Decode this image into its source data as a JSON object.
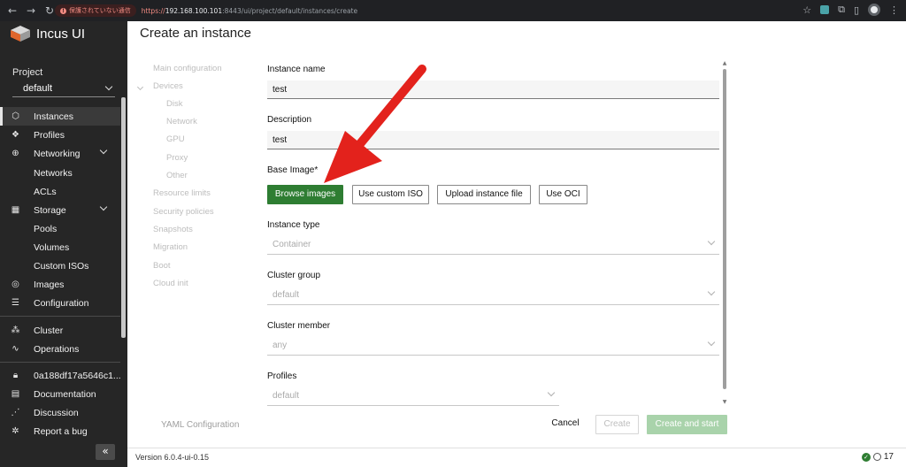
{
  "browser": {
    "security_warning": "保護されていない通信",
    "url_scheme": "https://",
    "url_host": "192.168.100.101",
    "url_rest": ":8443/ui/project/default/instances/create"
  },
  "sidebar": {
    "brand": "Incus UI",
    "project_label": "Project",
    "project_value": "default",
    "items": [
      {
        "label": "Instances",
        "icon": "instances-icon"
      },
      {
        "label": "Profiles",
        "icon": "profiles-icon"
      },
      {
        "label": "Networking",
        "icon": "networking-icon"
      },
      {
        "label": "Networks"
      },
      {
        "label": "ACLs"
      },
      {
        "label": "Storage",
        "icon": "storage-icon"
      },
      {
        "label": "Pools"
      },
      {
        "label": "Volumes"
      },
      {
        "label": "Custom ISOs"
      },
      {
        "label": "Images",
        "icon": "images-icon"
      },
      {
        "label": "Configuration",
        "icon": "configuration-icon"
      },
      {
        "label": "Cluster",
        "icon": "cluster-icon"
      },
      {
        "label": "Operations",
        "icon": "operations-icon"
      },
      {
        "label": "0a188df17a5646c1...",
        "icon": "lock-icon"
      },
      {
        "label": "Documentation",
        "icon": "documentation-icon"
      },
      {
        "label": "Discussion",
        "icon": "discussion-icon"
      },
      {
        "label": "Report a bug",
        "icon": "bug-icon"
      }
    ],
    "collapse_glyph": "«"
  },
  "main": {
    "title": "Create an instance",
    "steps": [
      "Main configuration",
      "Devices",
      "Disk",
      "Network",
      "GPU",
      "Proxy",
      "Other",
      "Resource limits",
      "Security policies",
      "Snapshots",
      "Migration",
      "Boot",
      "Cloud init"
    ],
    "form": {
      "instance_name_label": "Instance name",
      "instance_name_value": "test",
      "description_label": "Description",
      "description_value": "test",
      "base_image_label": "Base Image*",
      "browse_images": "Browse images",
      "use_custom_iso": "Use custom ISO",
      "upload_instance_file": "Upload instance file",
      "use_oci": "Use OCI",
      "instance_type_label": "Instance type",
      "instance_type_value": "Container",
      "cluster_group_label": "Cluster group",
      "cluster_group_value": "default",
      "cluster_member_label": "Cluster member",
      "cluster_member_value": "any",
      "profiles_label": "Profiles",
      "profiles_value": "default"
    },
    "actions": {
      "yaml": "YAML Configuration",
      "cancel": "Cancel",
      "create": "Create",
      "create_and_start": "Create and start"
    }
  },
  "footer": {
    "version": "Version 6.0.4-ui-0.15",
    "notification_count": "17"
  },
  "colors": {
    "sidebar_bg": "#262626",
    "primary_green": "#2e7d32",
    "annotation_arrow": "#e3221c"
  }
}
